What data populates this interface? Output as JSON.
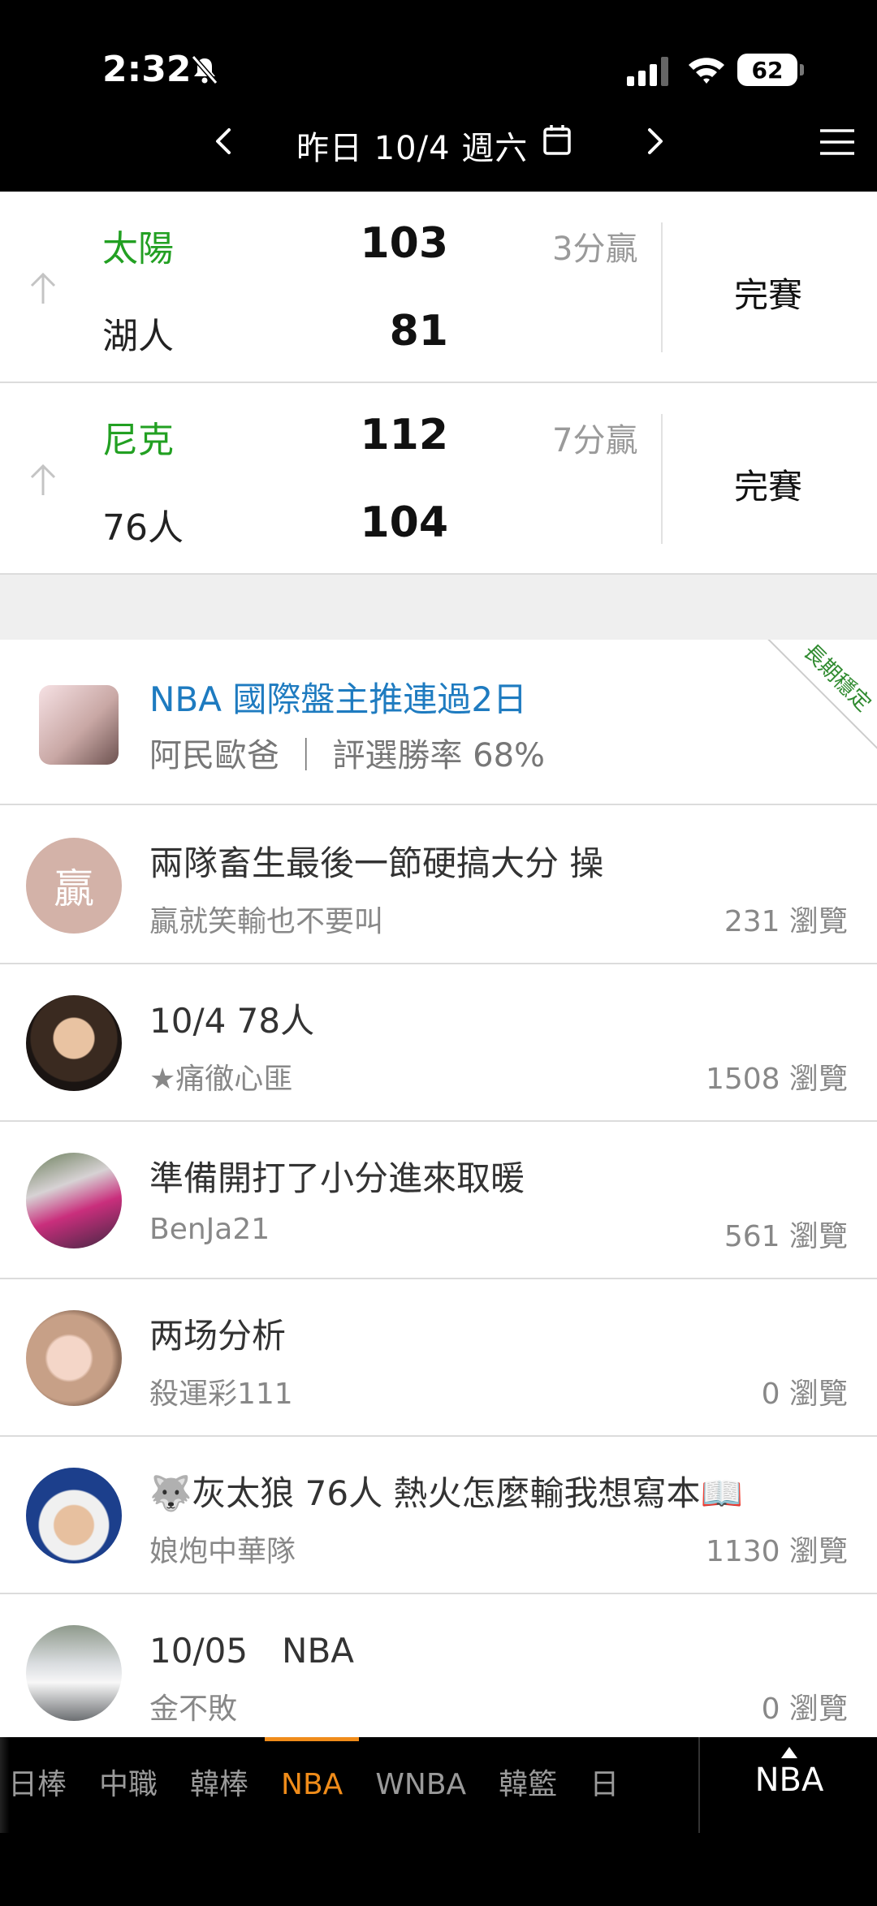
{
  "status": {
    "time": "2:32",
    "battery": "62"
  },
  "header": {
    "date": "昨日 10/4 週六"
  },
  "games": [
    {
      "home": "太陽",
      "home_score": "103",
      "away": "湖人",
      "away_score": "81",
      "margin": "3分贏",
      "status": "完賽"
    },
    {
      "home": "尼克",
      "home_score": "112",
      "away": "76人",
      "away_score": "104",
      "margin": "7分贏",
      "status": "完賽"
    }
  ],
  "promo": {
    "title": "NBA 國際盤主推連過2日",
    "meta": "阿民歐爸 ｜ 評選勝率 68%",
    "ribbon": "長期穩定"
  },
  "posts": [
    {
      "title": "兩隊畜生最後一節硬搞大分 操",
      "author": "贏就笑輸也不要叫",
      "views": "231 瀏覽",
      "avatar_text": "贏"
    },
    {
      "title": "10/4 78人",
      "author": "★痛徹心匪",
      "views": "1508 瀏覽"
    },
    {
      "title": "準備開打了小分進來取暖",
      "author": "BenJa21",
      "views": "561 瀏覽"
    },
    {
      "title": "两场分析",
      "author": "殺運彩111",
      "views": "0 瀏覽"
    },
    {
      "title": "🐺灰太狼 76人 熱火怎麼輸我想寫本📖",
      "author": "娘炮中華隊",
      "views": "1130 瀏覽"
    },
    {
      "title": "10/05　NBA",
      "author": "金不敗",
      "views": "0 瀏覽"
    }
  ],
  "tabs": [
    "日棒",
    "中職",
    "韓棒",
    "NBA",
    "WNBA",
    "韓籃",
    "日"
  ],
  "current_tab": "NBA",
  "colors": {
    "win": "#22a022",
    "link": "#1e7bc0",
    "accent": "#f08c1a"
  }
}
